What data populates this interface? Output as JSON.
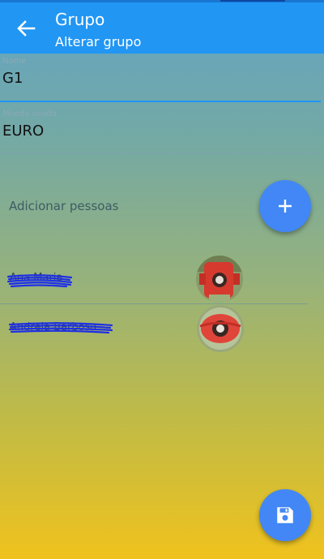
{
  "header": {
    "title": "Grupo",
    "subtitle": "Alterar grupo",
    "back_icon": "arrow-back-icon"
  },
  "form": {
    "name_label": "Nome",
    "name_value": "G1",
    "currency_label": "Moeda usada",
    "currency_value": "EURO"
  },
  "people_section": {
    "add_label": "Adicionar pessoas",
    "add_icon": "plus-icon",
    "people": [
      {
        "name": "Ana Maria"
      },
      {
        "name": "Andreia Barbosa"
      }
    ]
  },
  "save_icon": "floppy-disk-icon",
  "colors": {
    "appbar": "#2196f3",
    "fab": "#4287f5",
    "gradient_top": "#62a4c4",
    "gradient_bottom": "#f0c21d",
    "redaction": "#1e2fe6"
  }
}
